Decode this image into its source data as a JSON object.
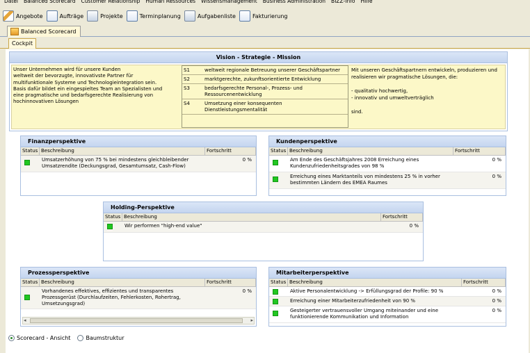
{
  "menu": [
    "Datei",
    "Balanced Scorecard",
    "Customer Relationship",
    "Human Ressources",
    "Wissensmanagement",
    "Business Administration",
    "BIZZ-Info",
    "Hilfe"
  ],
  "toolbar": [
    {
      "label": "Angebote",
      "icon": "offers-icon"
    },
    {
      "label": "Aufträge",
      "icon": "orders-icon"
    },
    {
      "label": "Projekte",
      "icon": "projects-icon"
    },
    {
      "label": "Terminplanung",
      "icon": "calendar-icon"
    },
    {
      "label": "Aufgabenliste",
      "icon": "tasklist-icon"
    },
    {
      "label": "Fakturierung",
      "icon": "invoicing-icon"
    }
  ],
  "main_tab": "Balanced Scorecard",
  "sub_tab": "Cockpit",
  "vision": {
    "title": "Vision - Strategie - Mission",
    "left_text": "Unser Unternehmen wird für unsere Kunden\nweltweit der bevorzugte, innovativste Partner für\nmultifunktionale Systeme und Technologieintegration sein.\nBasis dafür bildet ein eingespieltes Team an Spezialisten und\neine pragmatische und bedarfsgerechte Realisierung von\nhochinnovativen Lösungen",
    "strategies": [
      {
        "code": "S1",
        "text": "weltweit regionale Betreuung unserer Geschäftspartner"
      },
      {
        "code": "S2",
        "text": "marktgerechte, zukunftsorientierte Entwicklung"
      },
      {
        "code": "S3",
        "text": "bedarfsgerechte Personal-, Prozess- und Ressourcenentwicklung"
      },
      {
        "code": "S4",
        "text": "Umsetzung einer konsequenten Dienstleistungsmentalität"
      }
    ],
    "right_text": "Mit unseren Geschäftspartnern entwickeln, produzieren und realisieren wir pragmatische Lösungen, die:\n\n- qualitativ hochwertig,\n- innovativ und umweltverträglich\n\nsind."
  },
  "columns": {
    "status": "Status",
    "desc": "Beschreibung",
    "prog": "Fortschritt"
  },
  "finanz": {
    "title": "Finanzperspektive",
    "rows": [
      {
        "desc": "Umsatzerhöhung von 75 % bei mindestens gleichbleibender Umsatzrendite (Deckungsgrad, Gesamtumsatz, Cash-Flow)",
        "prog": "0 %"
      }
    ]
  },
  "kunden": {
    "title": "Kundenperspektive",
    "rows": [
      {
        "desc": "Am Ende des Geschäftsjahres 2008 Erreichung eines Kundenzufriedenheitsgrades von 98 %",
        "prog": "0 %"
      },
      {
        "desc": "Erreichung eines Marktanteils von mindestens 25 % in vorher bestimmten Ländern des EMEA Raumes",
        "prog": "0 %"
      }
    ]
  },
  "holding": {
    "title": "Holding-Perspektive",
    "rows": [
      {
        "desc": "Wir performen \"high-end value\"",
        "prog": "0 %"
      }
    ]
  },
  "prozess": {
    "title": "Prozessperspektive",
    "rows": [
      {
        "desc": "Vorhandenes effektives, effizientes und transparentes Prozessgerüst (Durchlaufzeiten, Fehlerkosten, Rohertrag, Umsetzungsgrad)",
        "prog": "0 %"
      }
    ]
  },
  "mitarbeiter": {
    "title": "Mitarbeiterperspektive",
    "rows": [
      {
        "desc": "Aktive Personalentwicklung -> Erfüllungsgrad der Profile: 90 %",
        "prog": "0 %"
      },
      {
        "desc": "Erreichung einer Mitarbeiterzufriedenheit von 90 %",
        "prog": "0 %"
      },
      {
        "desc": "Gesteigerter vertrauensvoller Umgang miteinander und eine funktionierende Kommunikation und Information",
        "prog": "0 %"
      }
    ]
  },
  "status_color": "#21c721",
  "view": {
    "option1": "Scorecard - Ansicht",
    "option2": "Baumstruktur",
    "selected": "Scorecard - Ansicht"
  }
}
